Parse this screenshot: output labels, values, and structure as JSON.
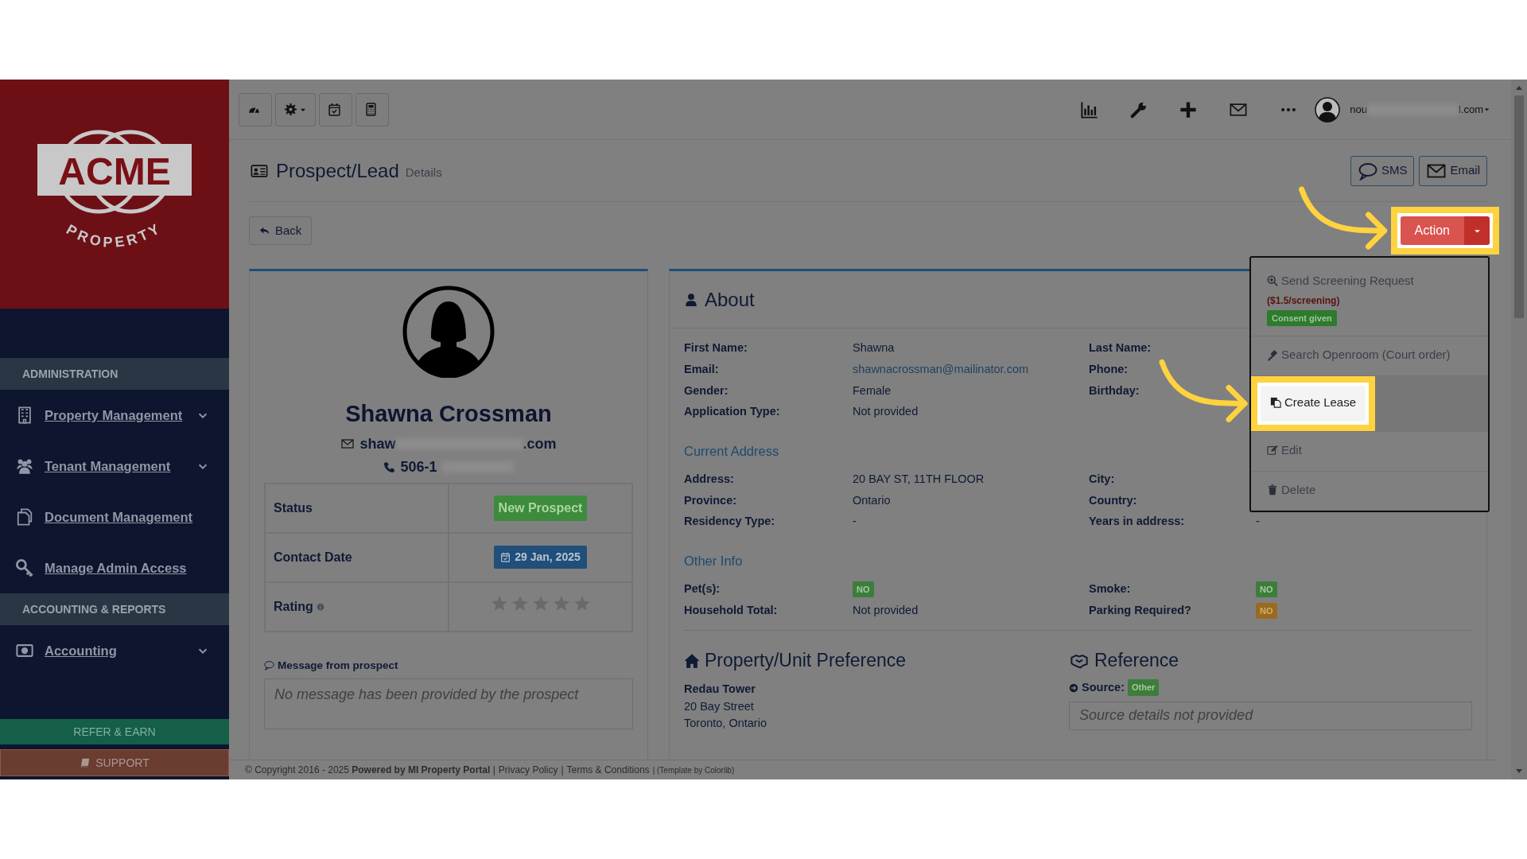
{
  "topbar": {
    "tools": [
      {
        "has_menu": false
      },
      {
        "has_menu": true
      },
      {
        "has_menu": false
      },
      {
        "has_menu": false
      }
    ],
    "user": {
      "name_start": "nou",
      "name_end": "l.com"
    }
  },
  "sidebar": {
    "logo": {
      "name": "ACME",
      "tagline": "PROPERTY"
    },
    "items": [
      {
        "kind": "header",
        "label": "ADMINISTRATION"
      },
      {
        "kind": "link",
        "label": "Property Management",
        "expandable": true
      },
      {
        "kind": "link",
        "label": "Tenant Management",
        "expandable": true
      },
      {
        "kind": "link",
        "label": "Document Management",
        "expandable": false
      },
      {
        "kind": "link",
        "label": "Manage Admin Access",
        "expandable": false
      },
      {
        "kind": "header",
        "label": "ACCOUNTING & REPORTS"
      },
      {
        "kind": "link",
        "label": "Accounting",
        "expandable": true
      }
    ],
    "refer_button": "REFER & EARN",
    "support_button": "SUPPORT"
  },
  "page": {
    "title": "Prospect/Lead",
    "subtitle": "Details",
    "buttons": [
      "SMS",
      "Email"
    ],
    "back": "Back",
    "action": {
      "label": "Action",
      "highlighted": true
    },
    "action_menu": [
      {
        "label": "Send Screening Request",
        "note": "($1.5/screening)",
        "badge": "Consent given",
        "highlighted": false
      },
      {
        "label": "Search Openroom (Court order)",
        "highlighted": false
      },
      {
        "label": "Create Lease",
        "highlighted": true
      },
      {
        "label": "Edit",
        "highlighted": false
      },
      {
        "label": "Delete",
        "highlighted": false
      }
    ]
  },
  "profile": {
    "name": "Shawna Crossman",
    "email_start": "shaw",
    "email_end": ".com",
    "phone_start": "506-1",
    "rows": [
      {
        "label": "Status",
        "kind": "status",
        "value": "New Prospect"
      },
      {
        "label": "Contact Date",
        "kind": "date",
        "value": "29 Jan, 2025"
      },
      {
        "label": "Rating",
        "kind": "rating",
        "stars": 0
      }
    ],
    "message_label": "Message from prospect",
    "message_placeholder": "No message has been provided by the prospect"
  },
  "about": {
    "title": "About",
    "sections": [
      {
        "rows": [
          {
            "left": {
              "label": "First Name:",
              "value": "Shawna",
              "kind": "text"
            },
            "right": {
              "label": "Last Name:"
            }
          },
          {
            "left": {
              "label": "Email:",
              "value": "shawnacrossman@mailinator.com",
              "kind": "link"
            },
            "right": {
              "label": "Phone:"
            }
          },
          {
            "left": {
              "label": "Gender:",
              "value": "Female",
              "kind": "text"
            },
            "right": {
              "label": "Birthday:"
            }
          },
          {
            "left": {
              "label": "Application Type:",
              "value": "Not provided",
              "kind": "text"
            }
          }
        ]
      },
      {
        "heading": "Current Address",
        "rows": [
          {
            "left": {
              "label": "Address:",
              "value": "20 BAY ST, 11TH FLOOR",
              "kind": "text"
            },
            "right": {
              "label": "City:"
            }
          },
          {
            "left": {
              "label": "Province:",
              "value": "Ontario",
              "kind": "text"
            },
            "right": {
              "label": "Country:"
            }
          },
          {
            "left": {
              "label": "Residency Type:",
              "value": "-",
              "kind": "text"
            },
            "right": {
              "label": "Years in address:",
              "value": "-",
              "kind": "text"
            }
          }
        ]
      },
      {
        "heading": "Other Info",
        "rows": [
          {
            "left": {
              "label": "Pet(s):",
              "value": "NO",
              "kind": "badge",
              "color": "#3d7d3c"
            },
            "right": {
              "label": "Smoke:",
              "value": "NO",
              "kind": "badge",
              "color": "#3d7d3c"
            }
          },
          {
            "left": {
              "label": "Household Total:",
              "value": "Not provided",
              "kind": "text"
            },
            "right": {
              "label": "Parking Required?",
              "value": "NO",
              "kind": "badge",
              "color": "#9a6a1e"
            }
          }
        ]
      }
    ]
  },
  "preference": {
    "title": "Property/Unit Preference",
    "name": "Redau Tower",
    "lines": [
      "20 Bay Street",
      "Toronto, Ontario"
    ]
  },
  "reference": {
    "title": "Reference",
    "source_label": "Source:",
    "source": "Other",
    "details_placeholder": "Source details not provided"
  },
  "footer": [
    {
      "kind": "text",
      "text": "© Copyright 2016 - 2025 **Powered by MI Property Portal** |"
    },
    {
      "kind": "link",
      "text": "Privacy Policy"
    },
    {
      "kind": "text",
      "text": "|"
    },
    {
      "kind": "link",
      "text": "Terms & Conditions"
    },
    {
      "kind": "small",
      "text": "| (Template by Colorlib)"
    }
  ]
}
